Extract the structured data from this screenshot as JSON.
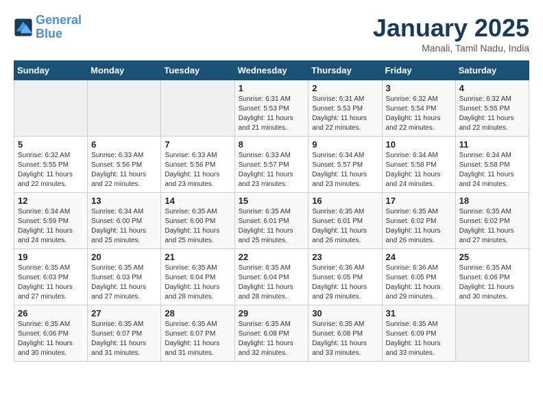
{
  "logo": {
    "line1": "General",
    "line2": "Blue"
  },
  "title": "January 2025",
  "subtitle": "Manali, Tamil Nadu, India",
  "days_of_week": [
    "Sunday",
    "Monday",
    "Tuesday",
    "Wednesday",
    "Thursday",
    "Friday",
    "Saturday"
  ],
  "weeks": [
    [
      {
        "day": "",
        "info": ""
      },
      {
        "day": "",
        "info": ""
      },
      {
        "day": "",
        "info": ""
      },
      {
        "day": "1",
        "info": "Sunrise: 6:31 AM\nSunset: 5:53 PM\nDaylight: 11 hours\nand 21 minutes."
      },
      {
        "day": "2",
        "info": "Sunrise: 6:31 AM\nSunset: 5:53 PM\nDaylight: 11 hours\nand 22 minutes."
      },
      {
        "day": "3",
        "info": "Sunrise: 6:32 AM\nSunset: 5:54 PM\nDaylight: 11 hours\nand 22 minutes."
      },
      {
        "day": "4",
        "info": "Sunrise: 6:32 AM\nSunset: 5:55 PM\nDaylight: 11 hours\nand 22 minutes."
      }
    ],
    [
      {
        "day": "5",
        "info": "Sunrise: 6:32 AM\nSunset: 5:55 PM\nDaylight: 11 hours\nand 22 minutes."
      },
      {
        "day": "6",
        "info": "Sunrise: 6:33 AM\nSunset: 5:56 PM\nDaylight: 11 hours\nand 22 minutes."
      },
      {
        "day": "7",
        "info": "Sunrise: 6:33 AM\nSunset: 5:56 PM\nDaylight: 11 hours\nand 23 minutes."
      },
      {
        "day": "8",
        "info": "Sunrise: 6:33 AM\nSunset: 5:57 PM\nDaylight: 11 hours\nand 23 minutes."
      },
      {
        "day": "9",
        "info": "Sunrise: 6:34 AM\nSunset: 5:57 PM\nDaylight: 11 hours\nand 23 minutes."
      },
      {
        "day": "10",
        "info": "Sunrise: 6:34 AM\nSunset: 5:58 PM\nDaylight: 11 hours\nand 24 minutes."
      },
      {
        "day": "11",
        "info": "Sunrise: 6:34 AM\nSunset: 5:58 PM\nDaylight: 11 hours\nand 24 minutes."
      }
    ],
    [
      {
        "day": "12",
        "info": "Sunrise: 6:34 AM\nSunset: 5:59 PM\nDaylight: 11 hours\nand 24 minutes."
      },
      {
        "day": "13",
        "info": "Sunrise: 6:34 AM\nSunset: 6:00 PM\nDaylight: 11 hours\nand 25 minutes."
      },
      {
        "day": "14",
        "info": "Sunrise: 6:35 AM\nSunset: 6:00 PM\nDaylight: 11 hours\nand 25 minutes."
      },
      {
        "day": "15",
        "info": "Sunrise: 6:35 AM\nSunset: 6:01 PM\nDaylight: 11 hours\nand 25 minutes."
      },
      {
        "day": "16",
        "info": "Sunrise: 6:35 AM\nSunset: 6:01 PM\nDaylight: 11 hours\nand 26 minutes."
      },
      {
        "day": "17",
        "info": "Sunrise: 6:35 AM\nSunset: 6:02 PM\nDaylight: 11 hours\nand 26 minutes."
      },
      {
        "day": "18",
        "info": "Sunrise: 6:35 AM\nSunset: 6:02 PM\nDaylight: 11 hours\nand 27 minutes."
      }
    ],
    [
      {
        "day": "19",
        "info": "Sunrise: 6:35 AM\nSunset: 6:03 PM\nDaylight: 11 hours\nand 27 minutes."
      },
      {
        "day": "20",
        "info": "Sunrise: 6:35 AM\nSunset: 6:03 PM\nDaylight: 11 hours\nand 27 minutes."
      },
      {
        "day": "21",
        "info": "Sunrise: 6:35 AM\nSunset: 6:04 PM\nDaylight: 11 hours\nand 28 minutes."
      },
      {
        "day": "22",
        "info": "Sunrise: 6:35 AM\nSunset: 6:04 PM\nDaylight: 11 hours\nand 28 minutes."
      },
      {
        "day": "23",
        "info": "Sunrise: 6:36 AM\nSunset: 6:05 PM\nDaylight: 11 hours\nand 29 minutes."
      },
      {
        "day": "24",
        "info": "Sunrise: 6:36 AM\nSunset: 6:05 PM\nDaylight: 11 hours\nand 29 minutes."
      },
      {
        "day": "25",
        "info": "Sunrise: 6:35 AM\nSunset: 6:06 PM\nDaylight: 11 hours\nand 30 minutes."
      }
    ],
    [
      {
        "day": "26",
        "info": "Sunrise: 6:35 AM\nSunset: 6:06 PM\nDaylight: 11 hours\nand 30 minutes."
      },
      {
        "day": "27",
        "info": "Sunrise: 6:35 AM\nSunset: 6:07 PM\nDaylight: 11 hours\nand 31 minutes."
      },
      {
        "day": "28",
        "info": "Sunrise: 6:35 AM\nSunset: 6:07 PM\nDaylight: 11 hours\nand 31 minutes."
      },
      {
        "day": "29",
        "info": "Sunrise: 6:35 AM\nSunset: 6:08 PM\nDaylight: 11 hours\nand 32 minutes."
      },
      {
        "day": "30",
        "info": "Sunrise: 6:35 AM\nSunset: 6:08 PM\nDaylight: 11 hours\nand 33 minutes."
      },
      {
        "day": "31",
        "info": "Sunrise: 6:35 AM\nSunset: 6:09 PM\nDaylight: 11 hours\nand 33 minutes."
      },
      {
        "day": "",
        "info": ""
      }
    ]
  ]
}
